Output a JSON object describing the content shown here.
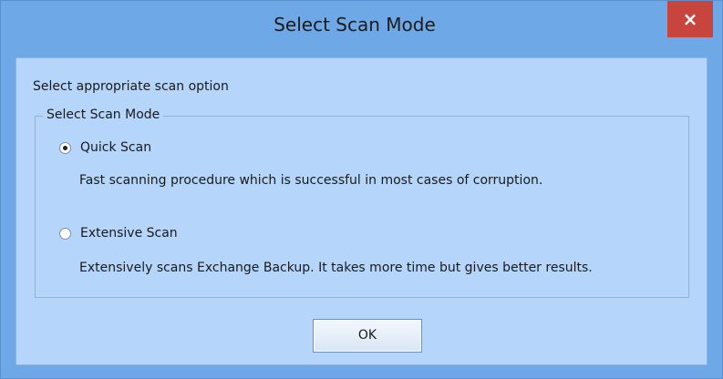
{
  "dialog": {
    "title": "Select Scan Mode",
    "close_label": "×"
  },
  "instruction": "Select appropriate scan option",
  "group": {
    "legend": "Select Scan Mode",
    "options": [
      {
        "label": "Quick Scan",
        "description": "Fast scanning procedure which is successful in most cases of corruption.",
        "selected": true
      },
      {
        "label": "Extensive Scan",
        "description": "Extensively scans Exchange Backup. It takes more time but gives better results.",
        "selected": false
      }
    ]
  },
  "buttons": {
    "ok_label": "OK"
  },
  "colors": {
    "frame": "#6fa8e6",
    "client": "#b5d5fb",
    "close": "#c8453d"
  }
}
